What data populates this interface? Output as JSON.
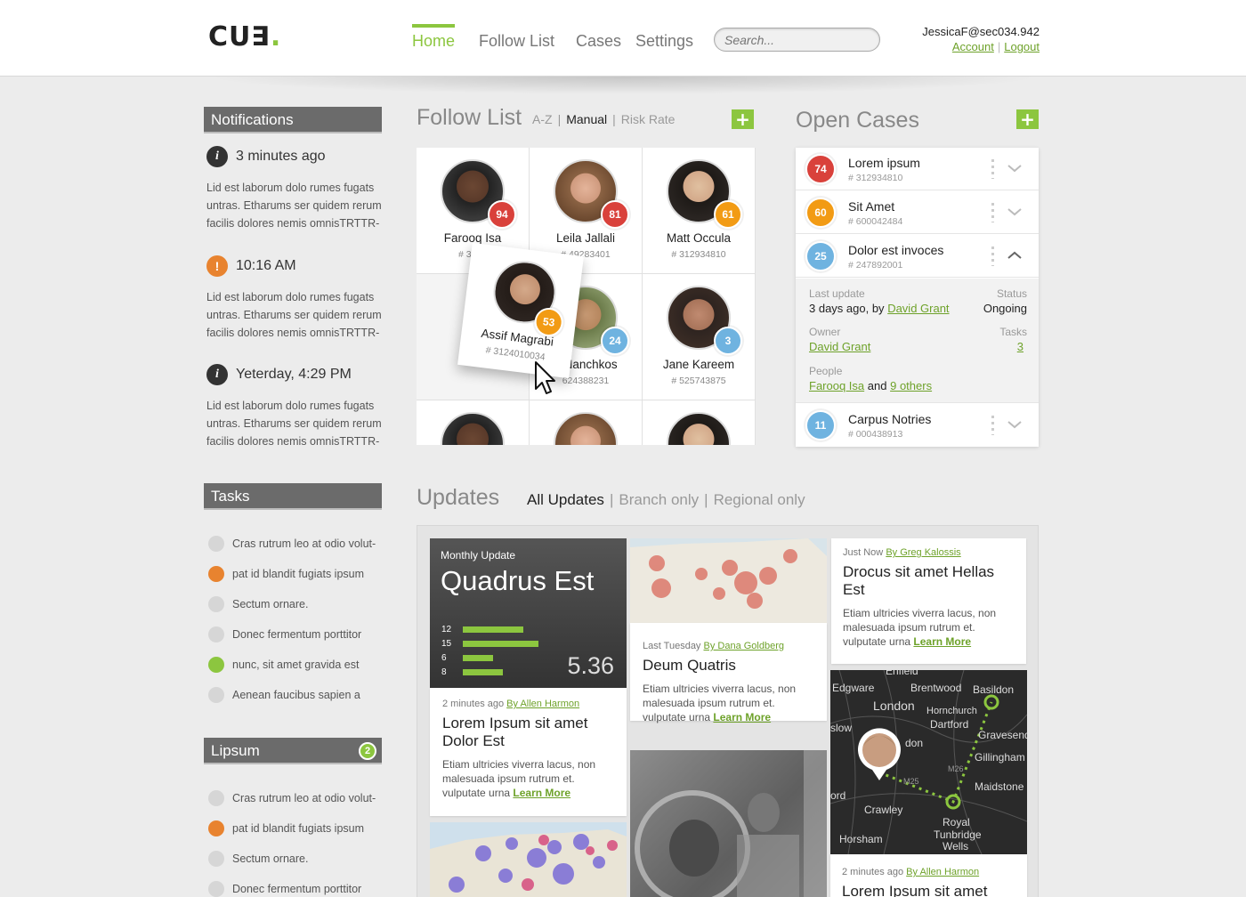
{
  "header": {
    "logo": "CU",
    "logo_dot": ".",
    "nav": [
      {
        "label": "Home",
        "active": true
      },
      {
        "label": "Follow List"
      },
      {
        "label": "Cases"
      },
      {
        "label": "Settings"
      }
    ],
    "search_placeholder": "Search...",
    "user_email": "JessicaF@sec034.942",
    "account_label": "Account",
    "logout_label": "Logout"
  },
  "notifications": {
    "title": "Notifications",
    "items": [
      {
        "icon": "info-icon",
        "time": "3 minutes ago",
        "text": "Lid est laborum dolo rumes fugats untras. Etharums ser quidem rerum facilis dolores nemis omnisTRTTR-"
      },
      {
        "icon": "warning-icon",
        "time": "10:16 AM",
        "text": "Lid est laborum dolo rumes fugats untras. Etharums ser quidem rerum facilis dolores nemis omnisTRTTR-"
      },
      {
        "icon": "info-icon",
        "time": "Yeterday, 4:29 PM",
        "text": "Lid est laborum dolo rumes fugats untras. Etharums ser quidem rerum facilis dolores nemis omnisTRTTR-"
      }
    ]
  },
  "tasks": {
    "title": "Tasks",
    "items": [
      {
        "label": "Cras rutrum leo at odio volut-",
        "status": "grey"
      },
      {
        "label": "pat id blandit fugiats ipsum",
        "status": "orange"
      },
      {
        "label": "Sectum ornare.",
        "status": "grey"
      },
      {
        "label": "Donec fermentum porttitor",
        "status": "grey"
      },
      {
        "label": "nunc, sit amet gravida est",
        "status": "green"
      },
      {
        "label": "Aenean faucibus sapien a",
        "status": "grey"
      }
    ]
  },
  "lipsum": {
    "title": "Lipsum",
    "count": "2",
    "items": [
      {
        "label": "Cras rutrum leo at odio volut-",
        "status": "grey"
      },
      {
        "label": "pat id blandit fugiats ipsum",
        "status": "orange"
      },
      {
        "label": "Sectum ornare.",
        "status": "grey"
      },
      {
        "label": "Donec fermentum porttitor",
        "status": "grey"
      }
    ]
  },
  "follow_list": {
    "title": "Follow List",
    "sort": [
      "A-Z",
      "Manual",
      "Risk Rate"
    ],
    "sort_active": "Manual",
    "people": [
      {
        "name": "Farooq Isa",
        "id": "# 3129",
        "score": "94",
        "color": "red"
      },
      {
        "name": "Leila Jallali",
        "id": "# 49283401",
        "score": "81",
        "color": "red"
      },
      {
        "name": "Matt Occula",
        "id": "# 312934810",
        "score": "61",
        "color": "orange"
      },
      {
        "name": "d Nanchkos",
        "id": "624388231",
        "score": "24",
        "color": "blue"
      },
      {
        "name": "Jane Kareem",
        "id": "# 525743875",
        "score": "3",
        "color": "blue"
      }
    ],
    "dragging": {
      "name": "Assif Magrabi",
      "id": "# 3124010034",
      "score": "53"
    }
  },
  "open_cases": {
    "title": "Open Cases",
    "cases": [
      {
        "score": "74",
        "color": "red",
        "name": "Lorem ipsum",
        "number": "# 312934810"
      },
      {
        "score": "60",
        "color": "orange",
        "name": "Sit Amet",
        "number": "# 600042484"
      },
      {
        "score": "25",
        "color": "blue",
        "name": "Dolor est invoces",
        "number": "# 247892001"
      },
      {
        "score": "11",
        "color": "blue",
        "name": "Carpus Notries",
        "number": "# 000438913"
      }
    ],
    "detail": {
      "last_update_label": "Last update",
      "last_update_value": "3 days ago, by",
      "last_update_by": "David Grant",
      "status_label": "Status",
      "status_value": "Ongoing",
      "owner_label": "Owner",
      "owner_value": "David Grant",
      "tasks_label": "Tasks",
      "tasks_value": "3",
      "people_label": "People",
      "people_first": "Farooq Isa",
      "people_and": "and",
      "people_others": "9 others"
    }
  },
  "updates": {
    "title": "Updates",
    "filters": [
      "All Updates",
      "Branch only",
      "Regional only"
    ],
    "filter_active": "All Updates",
    "monthly": {
      "kicker": "Monthly Update",
      "title": "Quadrus Est",
      "bars": [
        {
          "label": "12",
          "value": 12
        },
        {
          "label": "15",
          "value": 15
        },
        {
          "label": "6",
          "value": 6
        },
        {
          "label": "8",
          "value": 8
        }
      ],
      "total": "5.36"
    },
    "cards": [
      {
        "time": "2 minutes ago",
        "author": "By Allen Harmon",
        "title": "Lorem Ipsum sit amet Dolor Est",
        "text": "Etiam ultricies viverra lacus, non malesuada ipsum rutrum et. vulputate urna",
        "link": "Learn More"
      },
      {
        "time": "Last Tuesday",
        "author": "By Dana Goldberg",
        "title": "Deum Quatris",
        "text": "Etiam ultricies viverra lacus, non malesuada ipsum rutrum et. vulputate urna",
        "link": "Learn More"
      },
      {
        "time": "Just Now",
        "author": "By Greg Kalossis",
        "title": "Drocus sit amet Hellas Est",
        "text": "Etiam ultricies viverra lacus, non malesuada ipsum rutrum et. vulputate urna",
        "link": "Learn More"
      },
      {
        "time": "2 minutes ago",
        "author": "By Allen Harmon",
        "title": "Lorem Ipsum sit amet"
      }
    ],
    "map_labels": [
      "Edgware",
      "Enfield",
      "Brentwood",
      "Basildon",
      "London",
      "Hornchurch",
      "Dartford",
      "Gravesend",
      "slow",
      "don",
      "Gillingham",
      "Maidstone",
      "ord",
      "Crawley",
      "Royal",
      "Tunbridge",
      "Wells",
      "Horsham",
      "M25",
      "M26"
    ]
  }
}
